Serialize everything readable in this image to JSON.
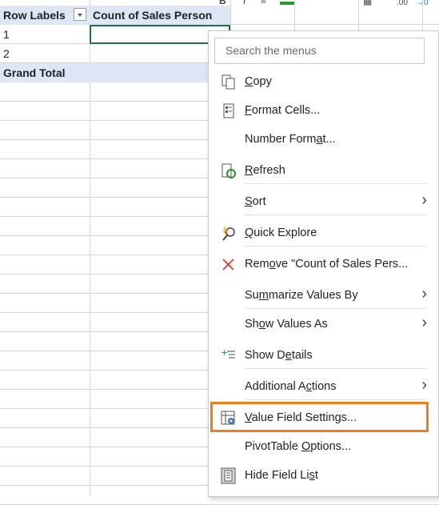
{
  "toolbar_fragment": {
    "bold": "B",
    "italic": "I",
    "decimal": ".00",
    "arrow": "→0"
  },
  "pivot": {
    "header_row_labels": "Row Labels",
    "header_value": "Count of Sales Person",
    "rows": [
      "1",
      "2"
    ],
    "grand_total": "Grand Total"
  },
  "menu": {
    "search_placeholder": "Search the menus",
    "items": [
      {
        "label": "Copy",
        "icon": "copy-icon"
      },
      {
        "label": "Format Cells...",
        "icon": "format-cells-icon"
      },
      {
        "label": "Number Format...",
        "icon": ""
      },
      {
        "label": "Refresh",
        "icon": "refresh-icon"
      },
      {
        "label": "Sort",
        "icon": "",
        "submenu": true
      },
      {
        "label": "Quick Explore",
        "icon": "quick-explore-icon"
      },
      {
        "label": "Remove \"Count of Sales Pers...",
        "icon": "remove-icon"
      },
      {
        "label": "Summarize Values By",
        "icon": "",
        "submenu": true
      },
      {
        "label": "Show Values As",
        "icon": "",
        "submenu": true
      },
      {
        "label": "Show Details",
        "icon": "show-details-icon"
      },
      {
        "label": "Additional Actions",
        "icon": "",
        "submenu": true
      },
      {
        "label": "Value Field Settings...",
        "icon": "value-field-settings-icon"
      },
      {
        "label": "PivotTable Options...",
        "icon": ""
      },
      {
        "label": "Hide Field List",
        "icon": "hide-field-list-icon"
      }
    ]
  },
  "colors": {
    "header_fill": "#dde6f4",
    "selection_border": "#217346",
    "highlight_border": "#f07d1a",
    "remove_red": "#d9382c"
  }
}
